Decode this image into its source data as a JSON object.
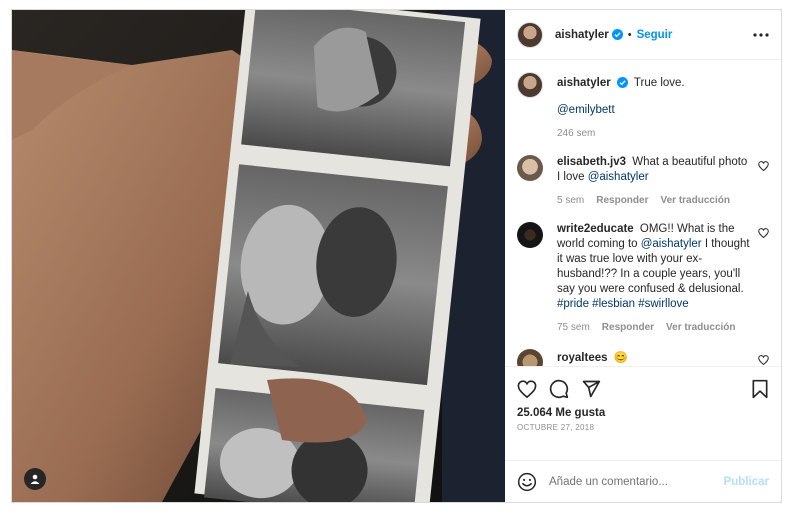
{
  "post": {
    "author": "aishatyler",
    "follow_label": "Seguir",
    "separator": "•",
    "caption": {
      "text": "True love.",
      "mention": "@emilybett",
      "age": "246 sem"
    },
    "comments": [
      {
        "user": "elisabeth.jv3",
        "text_before": "What a beautiful photo I love ",
        "mention": "@aishatyler",
        "text_after": "",
        "age": "5 sem",
        "reply_label": "Responder",
        "translate_label": "Ver traducción"
      },
      {
        "user": "write2educate",
        "text_before": "OMG!! What is the world coming to ",
        "mention": "@aishatyler",
        "text_after": " I thought it was true love with your ex-husband!?? In a couple years, you'll say you were confused & delusional. ",
        "tags": [
          "#pride",
          "#lesbian",
          "#swirllove"
        ],
        "age": "75 sem",
        "reply_label": "Responder",
        "translate_label": "Ver traducción"
      },
      {
        "user": "royaltees",
        "text_before": "😊"
      }
    ],
    "likes": "25.064 Me gusta",
    "date": "OCTUBRE 27, 2018",
    "composer": {
      "placeholder": "Añade un comentario...",
      "publish_label": "Publicar"
    }
  },
  "icons": {
    "heart": "heart-icon",
    "comment": "comment-icon",
    "share": "share-icon",
    "save": "bookmark-icon",
    "more": "more-options-icon",
    "emoji": "emoji-icon",
    "tag": "user-tag-icon",
    "verified": "verified-badge-icon"
  },
  "colors": {
    "accent": "#0095f6",
    "link": "#00376b",
    "muted": "#8e8e8e",
    "publish_disabled": "#b2dffc"
  }
}
